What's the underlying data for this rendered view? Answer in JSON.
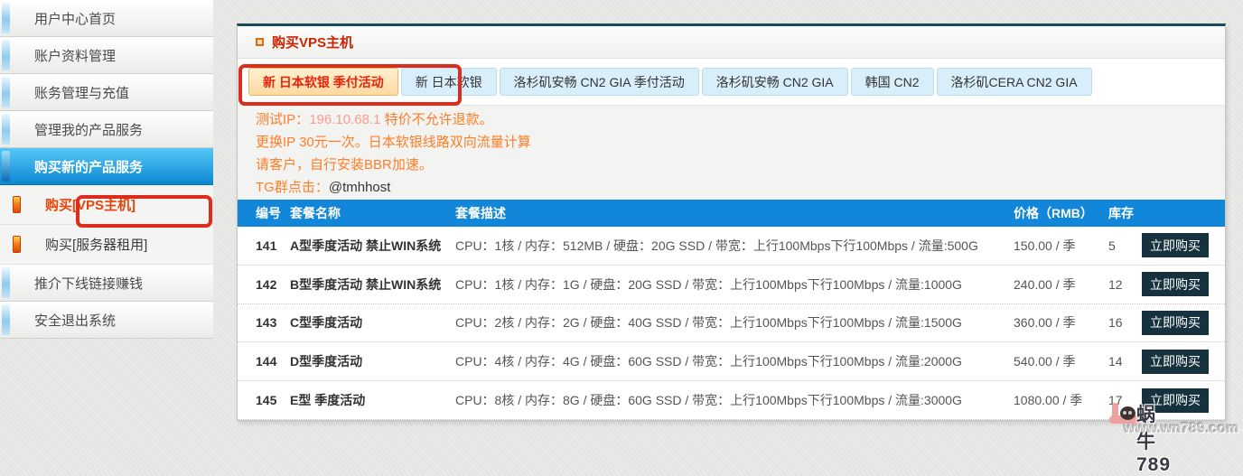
{
  "colors": {
    "table_header_blue": "#1287d9",
    "notice_orange": "#ff7d27",
    "annotation_red": "#dd2b1c",
    "buy_button_dark": "#16323e",
    "panel_title_red": "#cc2200",
    "active_sidebar_blue": "#0d87d2",
    "active_tab_bg": "#ffd9a0"
  },
  "sidebar": {
    "items": [
      {
        "label": "用户中心首页"
      },
      {
        "label": "账户资料管理"
      },
      {
        "label": "账务管理与充值"
      },
      {
        "label": "管理我的产品服务"
      },
      {
        "label": "购买新的产品服务"
      },
      {
        "label": "购买[VPS主机]"
      },
      {
        "label": "购买[服务器租用]"
      },
      {
        "label": "推介下线链接赚钱"
      },
      {
        "label": "安全退出系统"
      }
    ]
  },
  "panel": {
    "title": "购买VPS主机",
    "tabs": [
      {
        "label": "新 日本软银 季付活动",
        "active": true
      },
      {
        "label": "新 日本软银",
        "active": false
      },
      {
        "label": "洛杉矶安畅 CN2 GIA 季付活动",
        "active": false
      },
      {
        "label": "洛杉矶安畅 CN2 GIA",
        "active": false
      },
      {
        "label": "韩国 CN2",
        "active": false
      },
      {
        "label": "洛杉矶CERA CN2 GIA",
        "active": false
      }
    ],
    "notices": {
      "line1_prefix": "测试IP：",
      "line1_ip": "196.10.68.1",
      "line1_suffix": " 特价不允许退款。",
      "line2": "更换IP 30元一次。日本软银线路双向流量计算",
      "line3": "请客户，自行安装BBR加速。",
      "line4_prefix": "TG群点击：",
      "line4_handle": "@tmhhost"
    },
    "table": {
      "headers": {
        "id": "编号",
        "name": "套餐名称",
        "desc": "套餐描述",
        "price": "价格（RMB）",
        "stock": "库存"
      },
      "buy_label": "立即购买",
      "rows": [
        {
          "id": "141",
          "name": "A型季度活动 禁止WIN系统",
          "desc": "CPU：1核 / 内存：512MB / 硬盘：20G SSD / 带宽：上行100Mbps下行100Mbps / 流量:500G",
          "price": "150.00 / 季",
          "stock": "5"
        },
        {
          "id": "142",
          "name": "B型季度活动 禁止WIN系统",
          "desc": "CPU：1核 / 内存：1G / 硬盘：20G SSD / 带宽：上行100Mbps下行100Mbps / 流量:1000G",
          "price": "240.00 / 季",
          "stock": "12"
        },
        {
          "id": "143",
          "name": "C型季度活动",
          "desc": "CPU：2核 / 内存：2G / 硬盘：40G SSD / 带宽：上行100Mbps下行100Mbps / 流量:1500G",
          "price": "360.00 / 季",
          "stock": "16"
        },
        {
          "id": "144",
          "name": "D型季度活动",
          "desc": "CPU：4核 / 内存：4G / 硬盘：60G SSD / 带宽：上行100Mbps下行100Mbps / 流量:2000G",
          "price": "540.00 / 季",
          "stock": "14"
        },
        {
          "id": "145",
          "name": "E型 季度活动",
          "desc": "CPU：8核 / 内存：8G / 硬盘：60G SSD / 带宽：上行100Mbps下行100Mbps / 流量:3000G",
          "price": "1080.00 / 季",
          "stock": "17"
        }
      ]
    }
  },
  "watermark": {
    "name": "蜗牛789",
    "url": "www.wn789.com"
  }
}
